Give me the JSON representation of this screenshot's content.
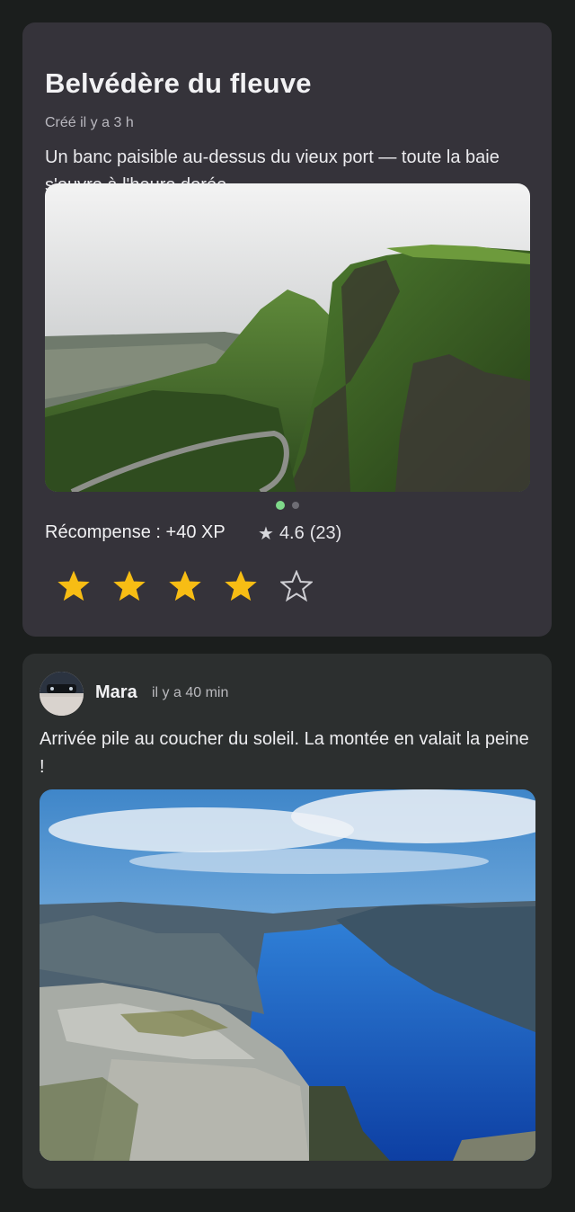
{
  "spot": {
    "title": "Belvédère du fleuve",
    "created": "Créé il y a 3 h",
    "description": "Un banc paisible au-dessus du vieux port — toute la baie s'ouvre à l'heure dorée.",
    "carousel": {
      "total": 2,
      "active": 1
    },
    "reward": "Récompense : +40 XP",
    "rating_value": "4.6",
    "rating_count": "(23)",
    "star_symbol": "★",
    "user_rating": {
      "filled": 4,
      "max": 5
    },
    "colors": {
      "accent_green": "#7fd98a",
      "star_yellow": "#f7bd14"
    }
  },
  "post": {
    "author": "Mara",
    "time": "il y a 40 min",
    "text": "Arrivée pile au coucher du soleil. La montée en valait la peine !"
  }
}
